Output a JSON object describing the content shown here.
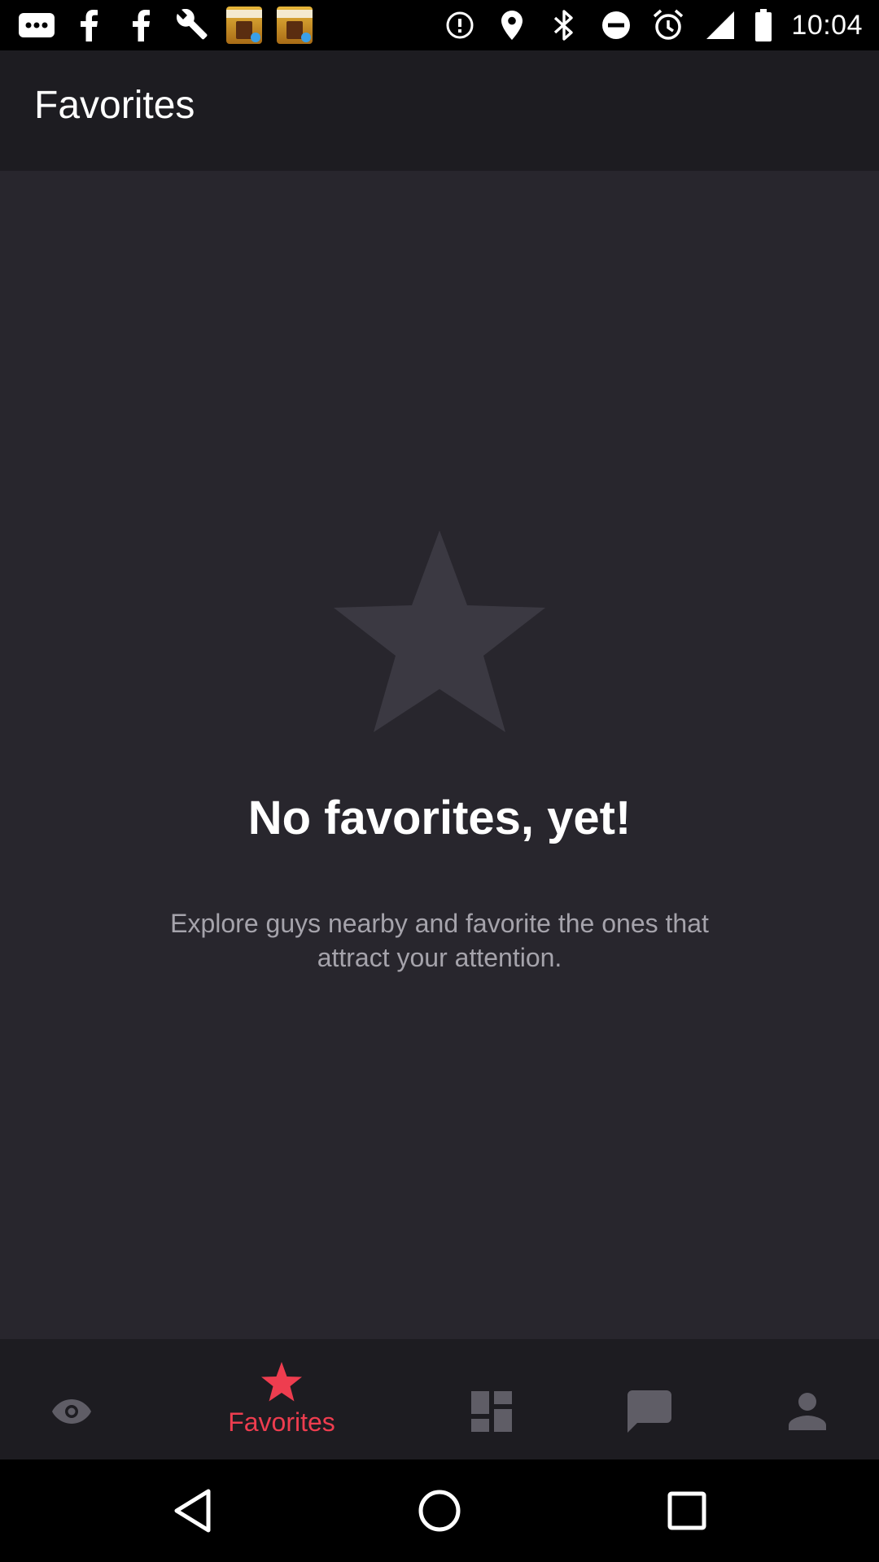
{
  "status_bar": {
    "time": "10:04",
    "left_icons": [
      "more-icon",
      "facebook-icon",
      "facebook-icon",
      "wrench-icon",
      "topics-app-icon",
      "topics-app-icon"
    ],
    "right_icons": [
      "data-saver-icon",
      "location-icon",
      "bluetooth-icon",
      "do-not-disturb-icon",
      "alarm-icon",
      "signal-icon",
      "battery-icon"
    ]
  },
  "header": {
    "title": "Favorites"
  },
  "empty_state": {
    "icon": "star-icon",
    "title": "No favorites, yet!",
    "description": "Explore guys nearby and favorite the ones that attract your attention."
  },
  "bottom_nav": {
    "items": [
      {
        "icon": "eye-icon",
        "label": "",
        "active": false
      },
      {
        "icon": "star-icon",
        "label": "Favorites",
        "active": true
      },
      {
        "icon": "grid-icon",
        "label": "",
        "active": false
      },
      {
        "icon": "chat-icon",
        "label": "",
        "active": false
      },
      {
        "icon": "profile-icon",
        "label": "",
        "active": false
      }
    ]
  },
  "colors": {
    "accent": "#ee3d4f",
    "background": "#28262d",
    "header_background": "#1d1c21",
    "inactive_icon": "#5f5d66",
    "empty_star": "#3b3942"
  },
  "system_nav": {
    "buttons": [
      "back-icon",
      "home-icon",
      "recents-icon"
    ]
  }
}
